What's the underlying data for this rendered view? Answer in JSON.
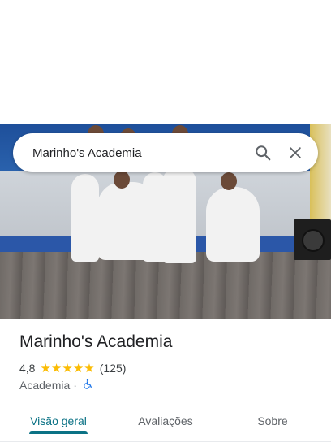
{
  "search": {
    "query": "Marinho's Academia",
    "search_icon": "search-icon",
    "close_icon": "close-icon"
  },
  "place": {
    "name": "Marinho's Academia",
    "rating": "4,8",
    "stars": 5,
    "reviews": "(125)",
    "category": "Academia",
    "separator": "·",
    "accessibility_icon": "wheelchair-icon"
  },
  "tabs": [
    {
      "label": "Visão geral",
      "active": true
    },
    {
      "label": "Avaliações",
      "active": false
    },
    {
      "label": "Sobre",
      "active": false
    }
  ],
  "colors": {
    "accent": "#0b7285",
    "star": "#fbbc04",
    "accessibility": "#1a73e8"
  }
}
